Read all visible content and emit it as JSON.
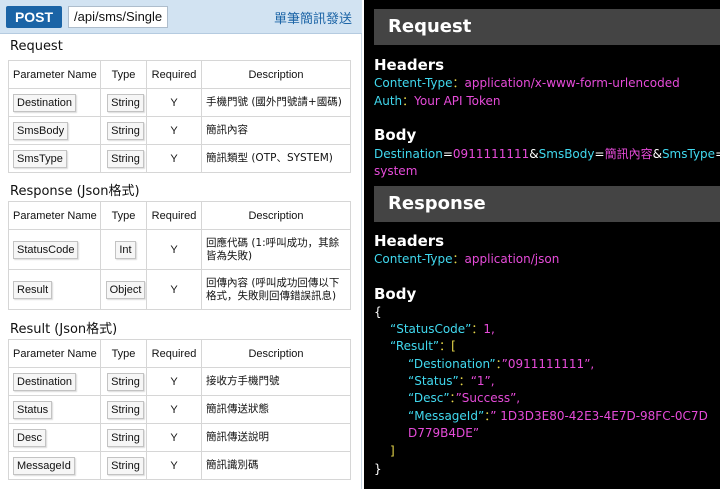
{
  "header": {
    "method": "POST",
    "path": "/api/sms/Single",
    "title": "單筆簡訊發送"
  },
  "columns": {
    "name": "Parameter Name",
    "type": "Type",
    "required": "Required",
    "description": "Description"
  },
  "request": {
    "title": "Request",
    "rows": [
      {
        "name": "Destination",
        "type": "String",
        "required": "Y",
        "desc": "手機門號 (國外門號請+國碼)"
      },
      {
        "name": "SmsBody",
        "type": "String",
        "required": "Y",
        "desc": "簡訊內容"
      },
      {
        "name": "SmsType",
        "type": "String",
        "required": "Y",
        "desc": "簡訊類型 (OTP、SYSTEM)"
      }
    ]
  },
  "response": {
    "title": "Response (Json格式)",
    "rows": [
      {
        "name": "StatusCode",
        "type": "Int",
        "required": "Y",
        "desc": "回應代碼 (1:呼叫成功，其餘皆為失敗)"
      },
      {
        "name": "Result",
        "type": "Object",
        "required": "Y",
        "desc": "回傳內容 (呼叫成功回傳以下格式，失敗則回傳錯誤訊息)"
      }
    ]
  },
  "result": {
    "title": "Result (Json格式)",
    "rows": [
      {
        "name": "Destination",
        "type": "String",
        "required": "Y",
        "desc": "接收方手機門號"
      },
      {
        "name": "Status",
        "type": "String",
        "required": "Y",
        "desc": "簡訊傳送狀態"
      },
      {
        "name": "Desc",
        "type": "String",
        "required": "Y",
        "desc": "簡訊傳送說明"
      },
      {
        "name": "MessageId",
        "type": "String",
        "required": "Y",
        "desc": "簡訊識別碼"
      }
    ]
  },
  "example": {
    "request_band": "Request",
    "headers_label": "Headers",
    "body_label": "Body",
    "req_ct_key": "Content-Type",
    "req_ct_val": "application/x-www-form-urlencoded",
    "req_auth_key": "Auth",
    "req_auth_val": "Your API Token",
    "sep": "：",
    "body_k1": "Destination",
    "body_v1": "0911111111",
    "body_k2": "SmsBody",
    "body_v2": "簡訊內容",
    "body_k3": "SmsType",
    "body_v3": "system",
    "eq": "=",
    "amp": "&",
    "response_band": "Response",
    "resp_ct_key": "Content-Type",
    "resp_ct_val": "application/json",
    "brace_open": "{",
    "brace_close": "}",
    "j_status_key": "“StatusCode”",
    "j_status_val": "1,",
    "j_result_key": "“Result”",
    "j_result_open": "[",
    "j_dest_key": "“Destionation”",
    "j_dest_val": "”0911111111”,",
    "j_stat_key": "“Status”",
    "j_stat_val": "“1”,",
    "j_desc_key": "“Desc”",
    "j_desc_val": "”Success”,",
    "j_msg_key": "“MessageId”",
    "j_msg_val1": "” 1D3D3E80-42E3-4E7D-98FC-0C7D",
    "j_msg_val2": "D779B4DE”",
    "j_result_close": "]",
    "colon": "："
  },
  "colors": {
    "accent_blue": "#1b64a6",
    "code_cyan": "#41d9ef",
    "code_magenta": "#e64bd9",
    "code_yellow": "#e8d84a"
  }
}
